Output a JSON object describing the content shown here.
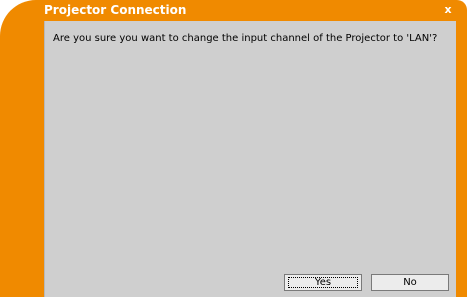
{
  "window": {
    "title": "Projector Connection",
    "close_glyph": "x",
    "accent_color": "#f08a00"
  },
  "dialog": {
    "message": "Are you sure you want to change the input channel of the Projector to 'LAN'?",
    "yes_label": "Yes",
    "no_label": "No",
    "default_button": "Yes"
  }
}
